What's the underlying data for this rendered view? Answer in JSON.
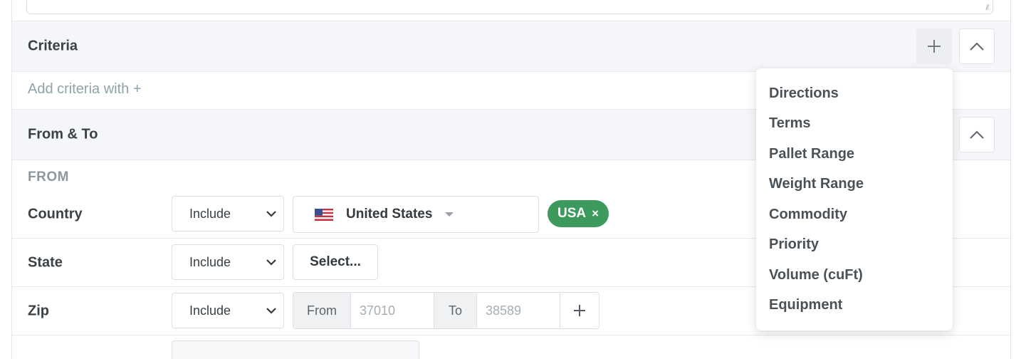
{
  "criteria": {
    "title": "Criteria",
    "hint": "Add criteria with +"
  },
  "from_to": {
    "title": "From & To",
    "from_heading": "FROM"
  },
  "rows": {
    "country": {
      "label": "Country",
      "mode": "Include",
      "country_value": "United States",
      "flag_icon": "us-flag-icon",
      "chip_label": "USA",
      "chip_remove": "×"
    },
    "state": {
      "label": "State",
      "mode": "Include",
      "select_label": "Select..."
    },
    "zip": {
      "label": "Zip",
      "mode": "Include",
      "from_label": "From",
      "from_placeholder": "37010",
      "to_label": "To",
      "to_placeholder": "38589"
    }
  },
  "criteria_menu": {
    "items": [
      "Directions",
      "Terms",
      "Pallet Range",
      "Weight Range",
      "Commodity",
      "Priority",
      "Volume (cuFt)",
      "Equipment"
    ]
  },
  "colors": {
    "chip_green": "#3c9a5c",
    "header_bg": "#f5f6fa",
    "hint_text": "#8fa3a9"
  }
}
